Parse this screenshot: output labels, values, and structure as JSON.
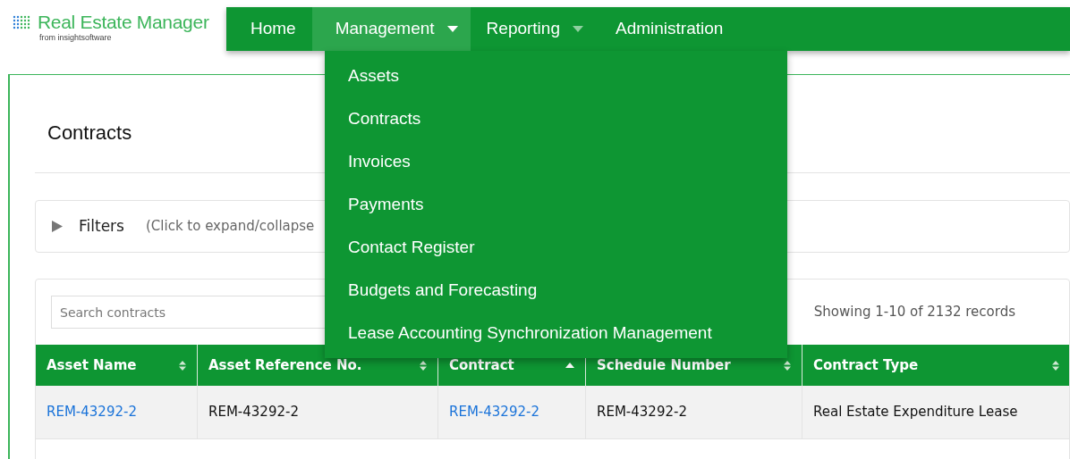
{
  "logo": {
    "name": "Real Estate Manager",
    "tagline": "from insightsoftware"
  },
  "nav": [
    {
      "label": "Home",
      "has_menu": false,
      "selected": false
    },
    {
      "label": "Management",
      "has_menu": true,
      "selected": true
    },
    {
      "label": "Reporting",
      "has_menu": true,
      "selected": false
    },
    {
      "label": "Administration",
      "has_menu": false,
      "selected": false
    }
  ],
  "menu": {
    "expanded": true,
    "items": [
      "Assets",
      "Contracts",
      "Invoices",
      "Payments",
      "Contact Register",
      "Budgets and Forecasting",
      "Lease Accounting Synchronization Management"
    ]
  },
  "page_title": "Contracts",
  "filters": {
    "label": "Filters",
    "hint": "(Click to expand/collapse",
    "expanded": false
  },
  "search": {
    "placeholder": "Search contracts"
  },
  "records": "Showing 1-10 of 2132 records",
  "table": {
    "columns": [
      {
        "label": "Asset Name",
        "sorted": false
      },
      {
        "label": "Asset Reference No.",
        "sorted": false
      },
      {
        "label": "Contract",
        "sorted": true
      },
      {
        "label": "Schedule Number",
        "sorted": false
      },
      {
        "label": "Contract Type",
        "sorted": false
      }
    ],
    "rows": [
      [
        {
          "text": "REM-43292-2",
          "kind": "link"
        },
        {
          "text": "REM-43292-2",
          "kind": "text"
        },
        {
          "text": "REM-43292-2",
          "kind": "link"
        },
        {
          "text": "REM-43292-2",
          "kind": "text"
        },
        {
          "text": "Real Estate Expenditure Lease",
          "kind": "text"
        }
      ]
    ]
  }
}
